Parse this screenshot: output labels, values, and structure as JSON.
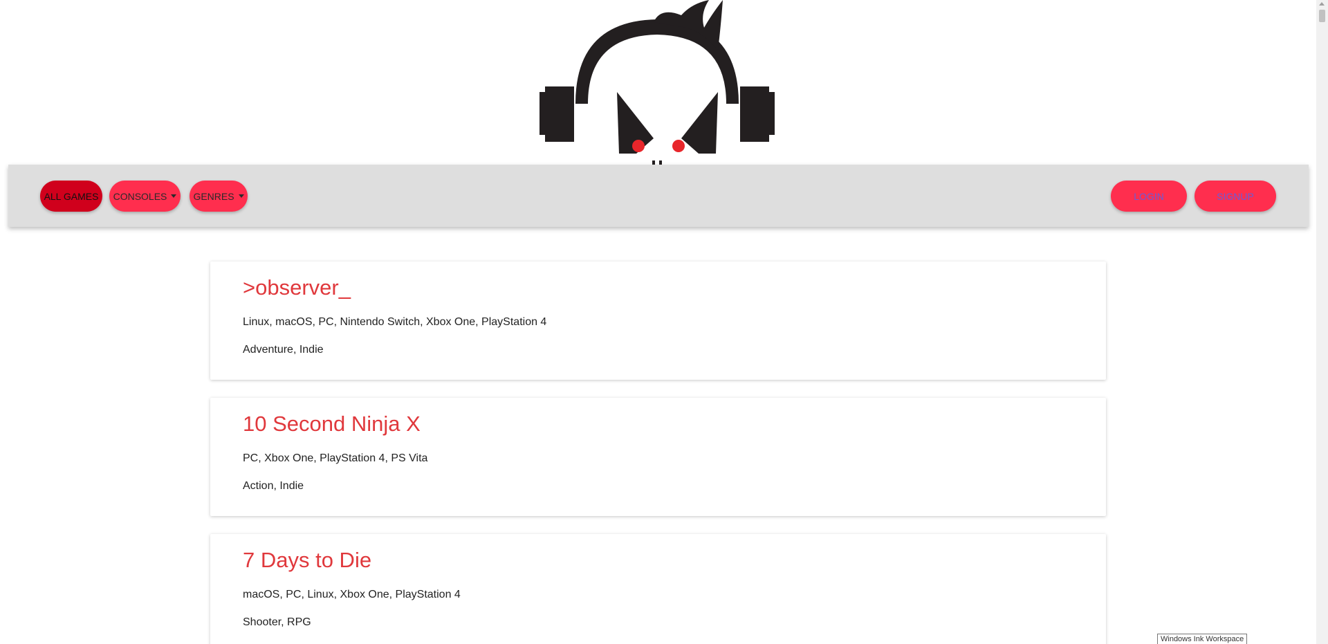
{
  "nav": {
    "left": [
      {
        "name": "all-games-button",
        "label": "ALL GAMES",
        "active": true
      },
      {
        "name": "consoles-dropdown",
        "label": "CONSOLES",
        "dropdown": true
      },
      {
        "name": "genres-dropdown",
        "label": "GENRES",
        "dropdown": true
      }
    ],
    "right": [
      {
        "name": "login-button",
        "label": "LOGIN"
      },
      {
        "name": "signup-button",
        "label": "SIGNUP"
      }
    ]
  },
  "games": [
    {
      "title": ">observer_",
      "platforms": "Linux, macOS, PC, Nintendo Switch, Xbox One, PlayStation 4",
      "genres": "Adventure, Indie"
    },
    {
      "title": "10 Second Ninja X",
      "platforms": "PC, Xbox One, PlayStation 4, PS Vita",
      "genres": "Action, Indie"
    },
    {
      "title": "7 Days to Die",
      "platforms": "macOS, PC, Linux, Xbox One, PlayStation 4",
      "genres": "Shooter, RPG"
    }
  ],
  "tooltip": "Windows Ink Workspace",
  "colors": {
    "accent": "#ff2e4e",
    "accent_active": "#d0001c",
    "title": "#e0383c",
    "navbar": "#dedede"
  },
  "icons": {
    "logo": "headphone-skull-logo-icon",
    "dropdown": "caret-down-icon"
  }
}
